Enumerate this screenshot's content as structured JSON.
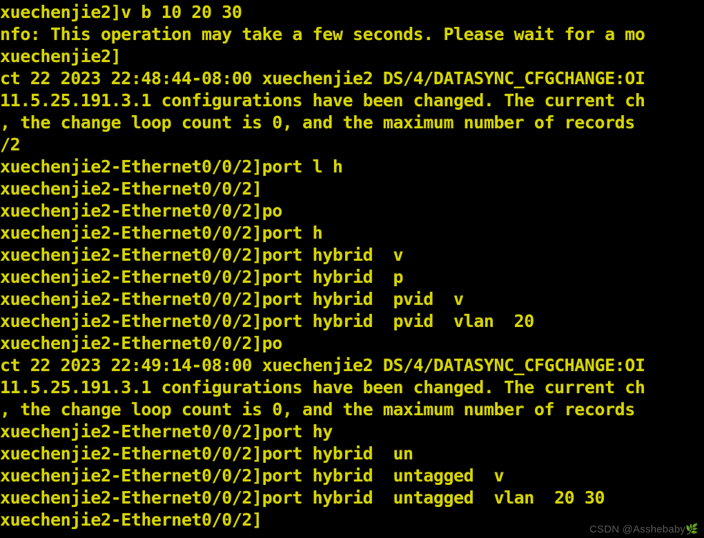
{
  "terminal": {
    "title": "Huawei switch CLI session",
    "colors": {
      "background": "#000000",
      "foreground": "#d6d600",
      "watermark": "#5a5a5a"
    },
    "prompt_device": "xuechenjie2",
    "interface": "Ethernet0/0/2",
    "lines": [
      "xuechenjie2]v b 10 20 30",
      "nfo: This operation may take a few seconds. Please wait for a mo",
      "xuechenjie2]",
      "ct 22 2023 22:48:44-08:00 xuechenjie2 DS/4/DATASYNC_CFGCHANGE:OI",
      "11.5.25.191.3.1 configurations have been changed. The current ch",
      ", the change loop count is 0, and the maximum number of records",
      "/2",
      "xuechenjie2-Ethernet0/0/2]port l h",
      "xuechenjie2-Ethernet0/0/2]",
      "xuechenjie2-Ethernet0/0/2]po",
      "xuechenjie2-Ethernet0/0/2]port h",
      "xuechenjie2-Ethernet0/0/2]port hybrid  v",
      "xuechenjie2-Ethernet0/0/2]port hybrid  p",
      "xuechenjie2-Ethernet0/0/2]port hybrid  pvid  v",
      "xuechenjie2-Ethernet0/0/2]port hybrid  pvid  vlan  20",
      "xuechenjie2-Ethernet0/0/2]po",
      "ct 22 2023 22:49:14-08:00 xuechenjie2 DS/4/DATASYNC_CFGCHANGE:OI",
      "11.5.25.191.3.1 configurations have been changed. The current ch",
      ", the change loop count is 0, and the maximum number of records",
      "xuechenjie2-Ethernet0/0/2]port hy",
      "xuechenjie2-Ethernet0/0/2]port hybrid  un",
      "xuechenjie2-Ethernet0/0/2]port hybrid  untagged  v",
      "xuechenjie2-Ethernet0/0/2]port hybrid  untagged  vlan  20 30",
      "xuechenjie2-Ethernet0/0/2]"
    ]
  },
  "watermark": {
    "text": "CSDN @Asshebaby🌿"
  }
}
